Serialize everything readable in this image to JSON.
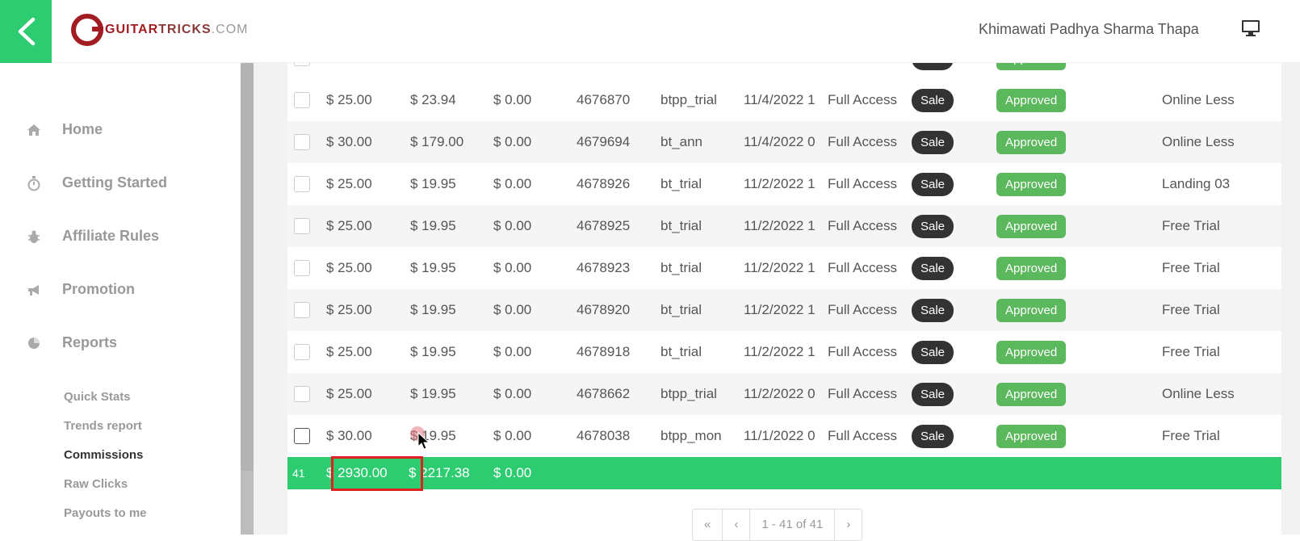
{
  "header": {
    "logo_primary": "GUITAR",
    "logo_secondary": "TRICKS",
    "logo_suffix": ".COM",
    "user_name": "Khimawati Padhya Sharma Thapa",
    "accent_color": "#2ecc71"
  },
  "sidebar": {
    "items": [
      {
        "label": "Home",
        "icon": "home-icon"
      },
      {
        "label": "Getting Started",
        "icon": "stopwatch-icon"
      },
      {
        "label": "Affiliate Rules",
        "icon": "bug-icon"
      },
      {
        "label": "Promotion",
        "icon": "bullhorn-icon"
      },
      {
        "label": "Reports",
        "icon": "pie-chart-icon"
      }
    ],
    "sub_items": [
      {
        "label": "Quick Stats"
      },
      {
        "label": "Trends report"
      },
      {
        "label": "Commissions",
        "active": true
      },
      {
        "label": "Raw Clicks"
      },
      {
        "label": "Payouts to me"
      }
    ]
  },
  "table": {
    "rows": [
      {
        "commission": "$ 25.00",
        "amount": "$ 23.94",
        "other": "$ 0.00",
        "order_id": "4676870",
        "code": "btpp_trial",
        "date": "11/4/2022 1",
        "product": "Full Access",
        "type": "Sale",
        "status": "Approved",
        "source": "Online Less"
      },
      {
        "commission": "$ 30.00",
        "amount": "$ 179.00",
        "other": "$ 0.00",
        "order_id": "4679694",
        "code": "bt_ann",
        "date": "11/4/2022 0",
        "product": "Full Access",
        "type": "Sale",
        "status": "Approved",
        "source": "Online Less"
      },
      {
        "commission": "$ 25.00",
        "amount": "$ 19.95",
        "other": "$ 0.00",
        "order_id": "4678926",
        "code": "bt_trial",
        "date": "11/2/2022 1",
        "product": "Full Access",
        "type": "Sale",
        "status": "Approved",
        "source": "Landing 03"
      },
      {
        "commission": "$ 25.00",
        "amount": "$ 19.95",
        "other": "$ 0.00",
        "order_id": "4678925",
        "code": "bt_trial",
        "date": "11/2/2022 1",
        "product": "Full Access",
        "type": "Sale",
        "status": "Approved",
        "source": "Free Trial"
      },
      {
        "commission": "$ 25.00",
        "amount": "$ 19.95",
        "other": "$ 0.00",
        "order_id": "4678923",
        "code": "bt_trial",
        "date": "11/2/2022 1",
        "product": "Full Access",
        "type": "Sale",
        "status": "Approved",
        "source": "Free Trial"
      },
      {
        "commission": "$ 25.00",
        "amount": "$ 19.95",
        "other": "$ 0.00",
        "order_id": "4678920",
        "code": "bt_trial",
        "date": "11/2/2022 1",
        "product": "Full Access",
        "type": "Sale",
        "status": "Approved",
        "source": "Free Trial"
      },
      {
        "commission": "$ 25.00",
        "amount": "$ 19.95",
        "other": "$ 0.00",
        "order_id": "4678918",
        "code": "bt_trial",
        "date": "11/2/2022 1",
        "product": "Full Access",
        "type": "Sale",
        "status": "Approved",
        "source": "Free Trial"
      },
      {
        "commission": "$ 25.00",
        "amount": "$ 19.95",
        "other": "$ 0.00",
        "order_id": "4678662",
        "code": "btpp_trial",
        "date": "11/2/2022 0",
        "product": "Full Access",
        "type": "Sale",
        "status": "Approved",
        "source": "Online Less"
      },
      {
        "commission": "$ 30.00",
        "amount": "$ 19.95",
        "other": "$ 0.00",
        "order_id": "4678038",
        "code": "btpp_mon",
        "date": "11/1/2022 0",
        "product": "Full Access",
        "type": "Sale",
        "status": "Approved",
        "source": "Free Trial"
      }
    ],
    "totals": {
      "count": "41",
      "commission": "$ 2930.00",
      "amount": "$ 2217.38",
      "other": "$ 0.00"
    }
  },
  "pagination": {
    "first": "«",
    "prev": "‹",
    "range": "1 - 41 of 41",
    "next": "›"
  }
}
